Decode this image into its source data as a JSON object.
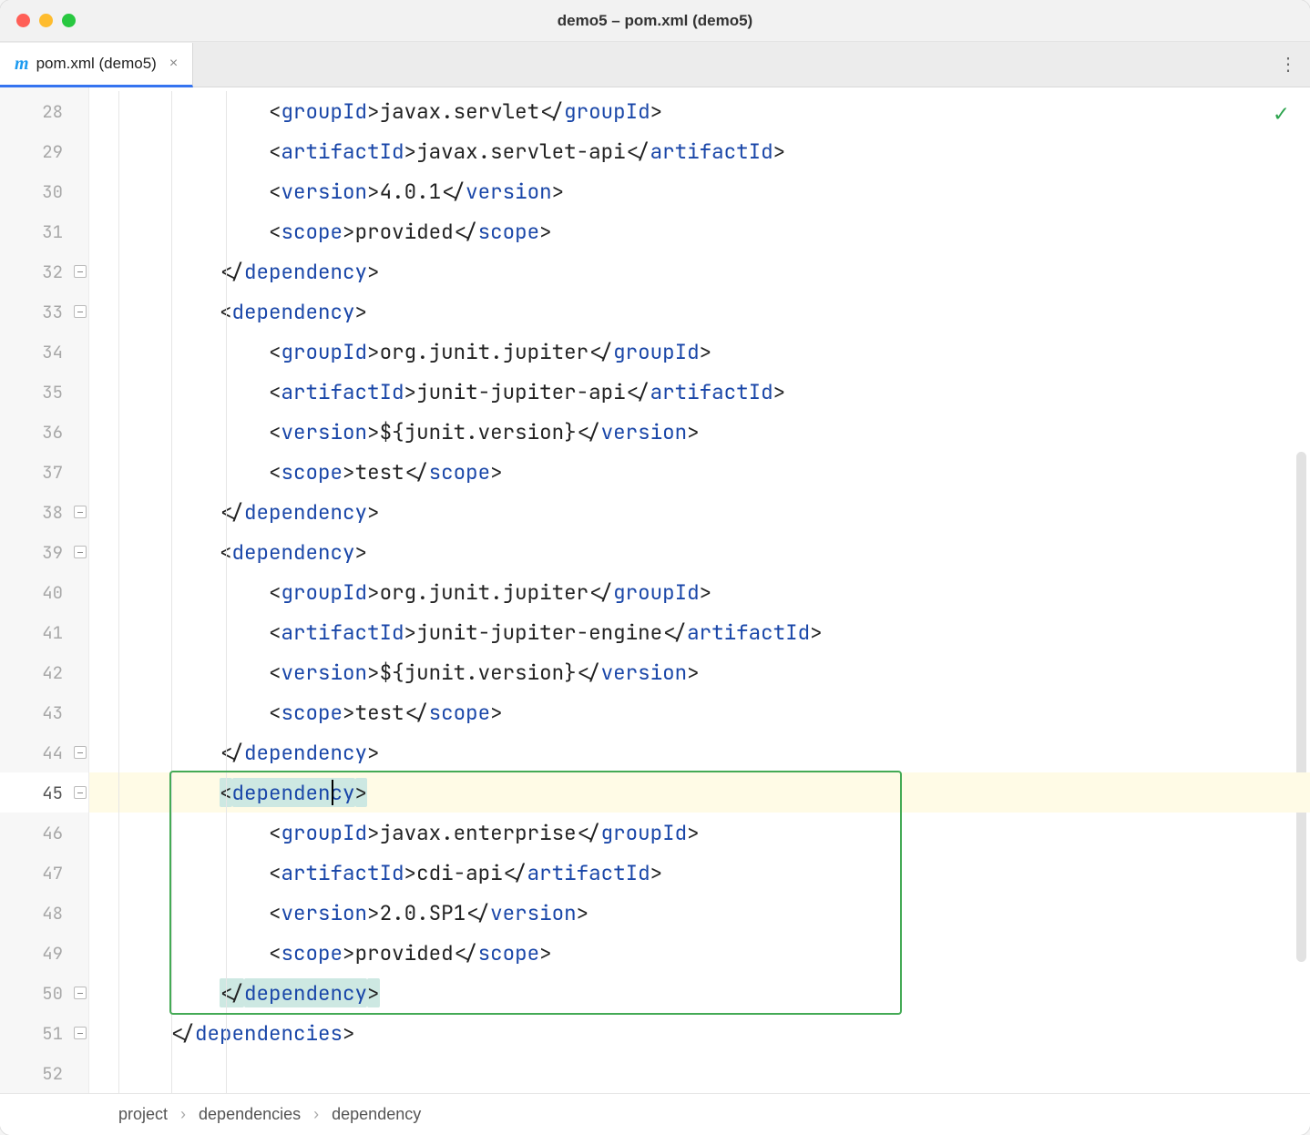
{
  "window": {
    "title": "demo5 – pom.xml (demo5)"
  },
  "tab": {
    "icon": "m",
    "label": "pom.xml (demo5)"
  },
  "lines": [
    {
      "n": 28,
      "indent": 3,
      "segs": [
        {
          "t": "angle",
          "v": "<"
        },
        {
          "t": "tag",
          "v": "groupId"
        },
        {
          "t": "angle",
          "v": ">"
        },
        {
          "t": "txt",
          "v": "javax.servlet"
        },
        {
          "t": "angle",
          "v": "</"
        },
        {
          "t": "tag",
          "v": "groupId"
        },
        {
          "t": "angle",
          "v": ">"
        }
      ]
    },
    {
      "n": 29,
      "indent": 3,
      "segs": [
        {
          "t": "angle",
          "v": "<"
        },
        {
          "t": "tag",
          "v": "artifactId"
        },
        {
          "t": "angle",
          "v": ">"
        },
        {
          "t": "txt",
          "v": "javax.servlet-api"
        },
        {
          "t": "angle",
          "v": "</"
        },
        {
          "t": "tag",
          "v": "artifactId"
        },
        {
          "t": "angle",
          "v": ">"
        }
      ]
    },
    {
      "n": 30,
      "indent": 3,
      "segs": [
        {
          "t": "angle",
          "v": "<"
        },
        {
          "t": "tag",
          "v": "version"
        },
        {
          "t": "angle",
          "v": ">"
        },
        {
          "t": "txt",
          "v": "4.0.1"
        },
        {
          "t": "angle",
          "v": "</"
        },
        {
          "t": "tag",
          "v": "version"
        },
        {
          "t": "angle",
          "v": ">"
        }
      ]
    },
    {
      "n": 31,
      "indent": 3,
      "segs": [
        {
          "t": "angle",
          "v": "<"
        },
        {
          "t": "tag",
          "v": "scope"
        },
        {
          "t": "angle",
          "v": ">"
        },
        {
          "t": "txt",
          "v": "provided"
        },
        {
          "t": "angle",
          "v": "</"
        },
        {
          "t": "tag",
          "v": "scope"
        },
        {
          "t": "angle",
          "v": ">"
        }
      ]
    },
    {
      "n": 32,
      "indent": 2,
      "fold": true,
      "segs": [
        {
          "t": "angle",
          "v": "</"
        },
        {
          "t": "tag",
          "v": "dependency"
        },
        {
          "t": "angle",
          "v": ">"
        }
      ]
    },
    {
      "n": 33,
      "indent": 2,
      "fold": true,
      "segs": [
        {
          "t": "angle",
          "v": "<"
        },
        {
          "t": "tag",
          "v": "dependency"
        },
        {
          "t": "angle",
          "v": ">"
        }
      ]
    },
    {
      "n": 34,
      "indent": 3,
      "segs": [
        {
          "t": "angle",
          "v": "<"
        },
        {
          "t": "tag",
          "v": "groupId"
        },
        {
          "t": "angle",
          "v": ">"
        },
        {
          "t": "txt",
          "v": "org.junit.jupiter"
        },
        {
          "t": "angle",
          "v": "</"
        },
        {
          "t": "tag",
          "v": "groupId"
        },
        {
          "t": "angle",
          "v": ">"
        }
      ]
    },
    {
      "n": 35,
      "indent": 3,
      "segs": [
        {
          "t": "angle",
          "v": "<"
        },
        {
          "t": "tag",
          "v": "artifactId"
        },
        {
          "t": "angle",
          "v": ">"
        },
        {
          "t": "txt",
          "v": "junit-jupiter-api"
        },
        {
          "t": "angle",
          "v": "</"
        },
        {
          "t": "tag",
          "v": "artifactId"
        },
        {
          "t": "angle",
          "v": ">"
        }
      ]
    },
    {
      "n": 36,
      "indent": 3,
      "segs": [
        {
          "t": "angle",
          "v": "<"
        },
        {
          "t": "tag",
          "v": "version"
        },
        {
          "t": "angle",
          "v": ">"
        },
        {
          "t": "txt",
          "v": "${junit.version}"
        },
        {
          "t": "angle",
          "v": "</"
        },
        {
          "t": "tag",
          "v": "version"
        },
        {
          "t": "angle",
          "v": ">"
        }
      ]
    },
    {
      "n": 37,
      "indent": 3,
      "segs": [
        {
          "t": "angle",
          "v": "<"
        },
        {
          "t": "tag",
          "v": "scope"
        },
        {
          "t": "angle",
          "v": ">"
        },
        {
          "t": "txt",
          "v": "test"
        },
        {
          "t": "angle",
          "v": "</"
        },
        {
          "t": "tag",
          "v": "scope"
        },
        {
          "t": "angle",
          "v": ">"
        }
      ]
    },
    {
      "n": 38,
      "indent": 2,
      "fold": true,
      "segs": [
        {
          "t": "angle",
          "v": "</"
        },
        {
          "t": "tag",
          "v": "dependency"
        },
        {
          "t": "angle",
          "v": ">"
        }
      ]
    },
    {
      "n": 39,
      "indent": 2,
      "fold": true,
      "segs": [
        {
          "t": "angle",
          "v": "<"
        },
        {
          "t": "tag",
          "v": "dependency"
        },
        {
          "t": "angle",
          "v": ">"
        }
      ]
    },
    {
      "n": 40,
      "indent": 3,
      "segs": [
        {
          "t": "angle",
          "v": "<"
        },
        {
          "t": "tag",
          "v": "groupId"
        },
        {
          "t": "angle",
          "v": ">"
        },
        {
          "t": "txt",
          "v": "org.junit.jupiter"
        },
        {
          "t": "angle",
          "v": "</"
        },
        {
          "t": "tag",
          "v": "groupId"
        },
        {
          "t": "angle",
          "v": ">"
        }
      ]
    },
    {
      "n": 41,
      "indent": 3,
      "segs": [
        {
          "t": "angle",
          "v": "<"
        },
        {
          "t": "tag",
          "v": "artifactId"
        },
        {
          "t": "angle",
          "v": ">"
        },
        {
          "t": "txt",
          "v": "junit-jupiter-engine"
        },
        {
          "t": "angle",
          "v": "</"
        },
        {
          "t": "tag",
          "v": "artifactId"
        },
        {
          "t": "angle",
          "v": ">"
        }
      ]
    },
    {
      "n": 42,
      "indent": 3,
      "segs": [
        {
          "t": "angle",
          "v": "<"
        },
        {
          "t": "tag",
          "v": "version"
        },
        {
          "t": "angle",
          "v": ">"
        },
        {
          "t": "txt",
          "v": "${junit.version}"
        },
        {
          "t": "angle",
          "v": "</"
        },
        {
          "t": "tag",
          "v": "version"
        },
        {
          "t": "angle",
          "v": ">"
        }
      ]
    },
    {
      "n": 43,
      "indent": 3,
      "segs": [
        {
          "t": "angle",
          "v": "<"
        },
        {
          "t": "tag",
          "v": "scope"
        },
        {
          "t": "angle",
          "v": ">"
        },
        {
          "t": "txt",
          "v": "test"
        },
        {
          "t": "angle",
          "v": "</"
        },
        {
          "t": "tag",
          "v": "scope"
        },
        {
          "t": "angle",
          "v": ">"
        }
      ]
    },
    {
      "n": 44,
      "indent": 2,
      "fold": true,
      "segs": [
        {
          "t": "angle",
          "v": "</"
        },
        {
          "t": "tag",
          "v": "dependency"
        },
        {
          "t": "angle",
          "v": ">"
        }
      ]
    },
    {
      "n": 45,
      "indent": 2,
      "fold": true,
      "current": true,
      "cursor": true,
      "segs": [
        {
          "t": "angle",
          "v": "<",
          "hl": true
        },
        {
          "t": "tag",
          "v": "dependency",
          "hl": true
        },
        {
          "t": "angle",
          "v": ">",
          "hl": true
        }
      ]
    },
    {
      "n": 46,
      "indent": 3,
      "segs": [
        {
          "t": "angle",
          "v": "<"
        },
        {
          "t": "tag",
          "v": "groupId"
        },
        {
          "t": "angle",
          "v": ">"
        },
        {
          "t": "txt",
          "v": "javax.enterprise"
        },
        {
          "t": "angle",
          "v": "</"
        },
        {
          "t": "tag",
          "v": "groupId"
        },
        {
          "t": "angle",
          "v": ">"
        }
      ]
    },
    {
      "n": 47,
      "indent": 3,
      "segs": [
        {
          "t": "angle",
          "v": "<"
        },
        {
          "t": "tag",
          "v": "artifactId"
        },
        {
          "t": "angle",
          "v": ">"
        },
        {
          "t": "txt",
          "v": "cdi-api"
        },
        {
          "t": "angle",
          "v": "</"
        },
        {
          "t": "tag",
          "v": "artifactId"
        },
        {
          "t": "angle",
          "v": ">"
        }
      ]
    },
    {
      "n": 48,
      "indent": 3,
      "segs": [
        {
          "t": "angle",
          "v": "<"
        },
        {
          "t": "tag",
          "v": "version"
        },
        {
          "t": "angle",
          "v": ">"
        },
        {
          "t": "txt",
          "v": "2.0.SP1"
        },
        {
          "t": "angle",
          "v": "</"
        },
        {
          "t": "tag",
          "v": "version"
        },
        {
          "t": "angle",
          "v": ">"
        }
      ]
    },
    {
      "n": 49,
      "indent": 3,
      "segs": [
        {
          "t": "angle",
          "v": "<"
        },
        {
          "t": "tag",
          "v": "scope"
        },
        {
          "t": "angle",
          "v": ">"
        },
        {
          "t": "txt",
          "v": "provided"
        },
        {
          "t": "angle",
          "v": "</"
        },
        {
          "t": "tag",
          "v": "scope"
        },
        {
          "t": "angle",
          "v": ">"
        }
      ]
    },
    {
      "n": 50,
      "indent": 2,
      "fold": true,
      "segs": [
        {
          "t": "angle",
          "v": "</",
          "hl": true
        },
        {
          "t": "tag",
          "v": "dependency",
          "hl": true
        },
        {
          "t": "angle",
          "v": ">",
          "hl": true
        }
      ]
    },
    {
      "n": 51,
      "indent": 1,
      "fold": true,
      "segs": [
        {
          "t": "angle",
          "v": "</"
        },
        {
          "t": "tag",
          "v": "dependencies"
        },
        {
          "t": "angle",
          "v": ">"
        }
      ]
    },
    {
      "n": 52,
      "indent": 0,
      "segs": []
    }
  ],
  "breadcrumb": [
    "project",
    "dependencies",
    "dependency"
  ],
  "status": {
    "ok_icon": "✓"
  }
}
